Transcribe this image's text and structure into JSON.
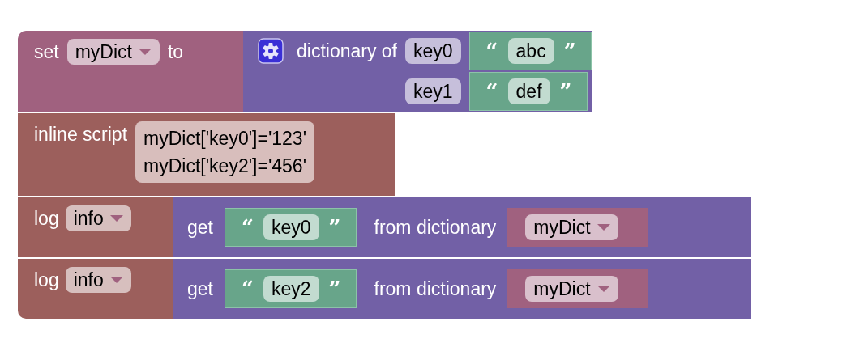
{
  "blocks": [
    {
      "kind": "set",
      "label": "set",
      "variable": "myDict",
      "connector": "to",
      "value": {
        "label": "dictionary of",
        "entries": [
          {
            "key": "key0",
            "value": {
              "open_quote": "“",
              "text": "abc",
              "close_quote": "”"
            }
          },
          {
            "key": "key1",
            "value": {
              "open_quote": "“",
              "text": "def",
              "close_quote": "”"
            }
          }
        ]
      }
    },
    {
      "kind": "inline_script",
      "label": "inline script",
      "code": [
        "myDict['key0']='123'",
        "myDict['key2']='456'"
      ]
    },
    {
      "kind": "log",
      "label": "log",
      "level": "info",
      "value": {
        "label": "get",
        "key": {
          "open_quote": "“",
          "text": "key0",
          "close_quote": "”"
        },
        "from_label": "from dictionary",
        "variable": "myDict"
      }
    },
    {
      "kind": "log",
      "label": "log",
      "level": "info",
      "value": {
        "label": "get",
        "key": {
          "open_quote": "“",
          "text": "key2",
          "close_quote": "”"
        },
        "from_label": "from dictionary",
        "variable": "myDict"
      }
    }
  ]
}
